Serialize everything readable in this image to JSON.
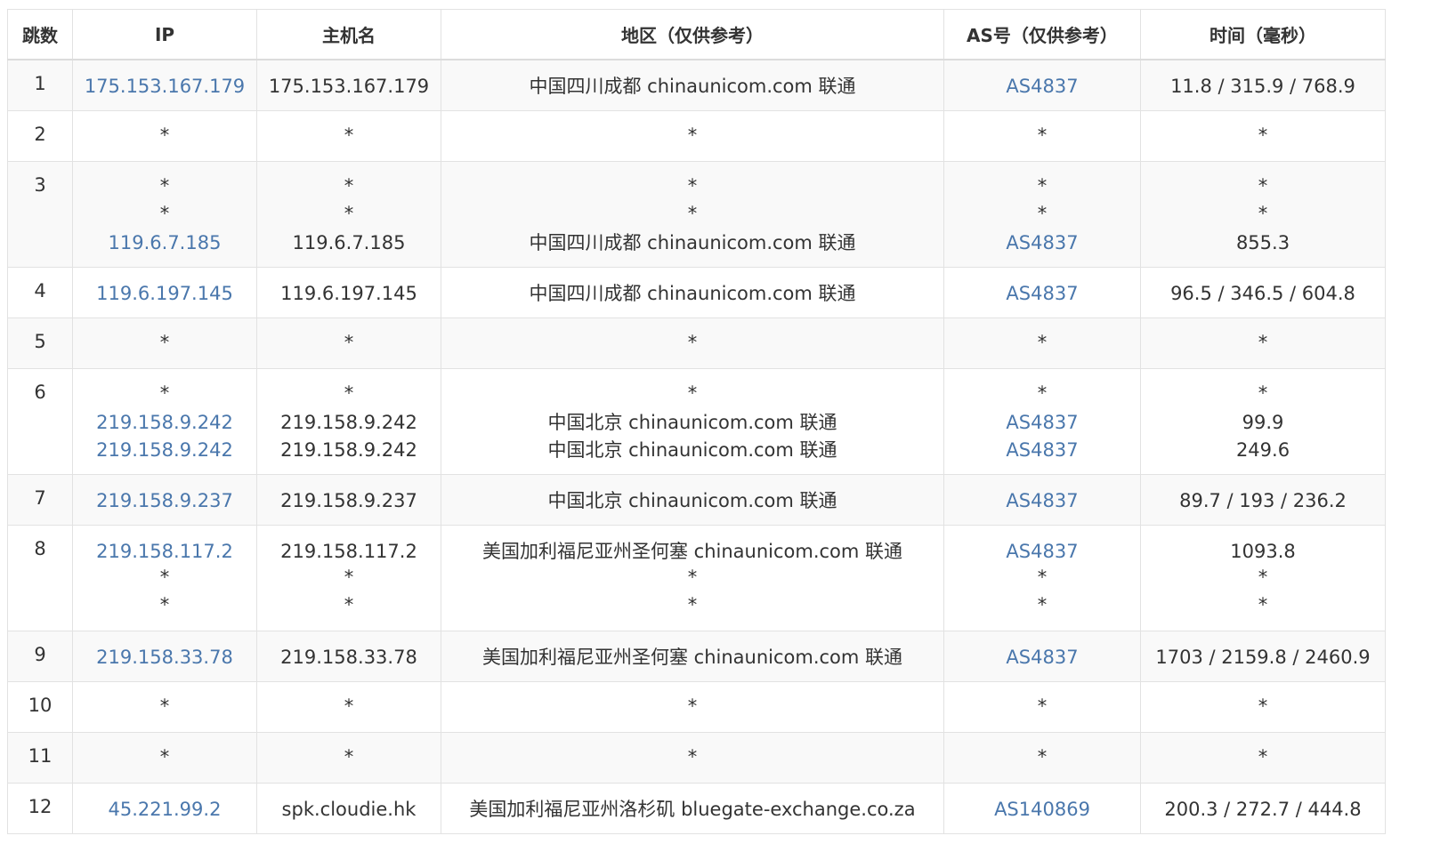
{
  "table": {
    "headers": {
      "hop": "跳数",
      "ip": "IP",
      "host": "主机名",
      "region": "地区（仅供参考）",
      "as": "AS号（仅供参考）",
      "time": "时间（毫秒）"
    },
    "rows": [
      {
        "hop": "1",
        "ip": [
          "175.153.167.179"
        ],
        "host": [
          "175.153.167.179"
        ],
        "region": [
          "中国四川成都 chinaunicom.com 联通"
        ],
        "as": [
          "AS4837"
        ],
        "time": [
          "11.8 / 315.9 / 768.9"
        ]
      },
      {
        "hop": "2",
        "ip": [
          "*"
        ],
        "host": [
          "*"
        ],
        "region": [
          "*"
        ],
        "as": [
          "*"
        ],
        "time": [
          "*"
        ]
      },
      {
        "hop": "3",
        "ip": [
          "*",
          "*",
          "119.6.7.185"
        ],
        "host": [
          "*",
          "*",
          "119.6.7.185"
        ],
        "region": [
          "*",
          "*",
          "中国四川成都 chinaunicom.com 联通"
        ],
        "as": [
          "*",
          "*",
          "AS4837"
        ],
        "time": [
          "*",
          "*",
          "855.3"
        ]
      },
      {
        "hop": "4",
        "ip": [
          "119.6.197.145"
        ],
        "host": [
          "119.6.197.145"
        ],
        "region": [
          "中国四川成都 chinaunicom.com 联通"
        ],
        "as": [
          "AS4837"
        ],
        "time": [
          "96.5 / 346.5 / 604.8"
        ]
      },
      {
        "hop": "5",
        "ip": [
          "*"
        ],
        "host": [
          "*"
        ],
        "region": [
          "*"
        ],
        "as": [
          "*"
        ],
        "time": [
          "*"
        ]
      },
      {
        "hop": "6",
        "ip": [
          "*",
          "219.158.9.242",
          "219.158.9.242"
        ],
        "host": [
          "*",
          "219.158.9.242",
          "219.158.9.242"
        ],
        "region": [
          "*",
          "中国北京 chinaunicom.com 联通",
          "中国北京 chinaunicom.com 联通"
        ],
        "as": [
          "*",
          "AS4837",
          "AS4837"
        ],
        "time": [
          "*",
          "99.9",
          "249.6"
        ]
      },
      {
        "hop": "7",
        "ip": [
          "219.158.9.237"
        ],
        "host": [
          "219.158.9.237"
        ],
        "region": [
          "中国北京 chinaunicom.com 联通"
        ],
        "as": [
          "AS4837"
        ],
        "time": [
          "89.7 / 193 / 236.2"
        ]
      },
      {
        "hop": "8",
        "ip": [
          "219.158.117.2",
          "*",
          "*"
        ],
        "host": [
          "219.158.117.2",
          "*",
          "*"
        ],
        "region": [
          "美国加利福尼亚州圣何塞 chinaunicom.com 联通",
          "*",
          "*"
        ],
        "as": [
          "AS4837",
          "*",
          "*"
        ],
        "time": [
          "1093.8",
          "*",
          "*"
        ]
      },
      {
        "hop": "9",
        "ip": [
          "219.158.33.78"
        ],
        "host": [
          "219.158.33.78"
        ],
        "region": [
          "美国加利福尼亚州圣何塞 chinaunicom.com 联通"
        ],
        "as": [
          "AS4837"
        ],
        "time": [
          "1703 / 2159.8 / 2460.9"
        ]
      },
      {
        "hop": "10",
        "ip": [
          "*"
        ],
        "host": [
          "*"
        ],
        "region": [
          "*"
        ],
        "as": [
          "*"
        ],
        "time": [
          "*"
        ]
      },
      {
        "hop": "11",
        "ip": [
          "*"
        ],
        "host": [
          "*"
        ],
        "region": [
          "*"
        ],
        "as": [
          "*"
        ],
        "time": [
          "*"
        ]
      },
      {
        "hop": "12",
        "ip": [
          "45.221.99.2"
        ],
        "host": [
          "spk.cloudie.hk"
        ],
        "region": [
          "美国加利福尼亚州洛杉矶 bluegate-exchange.co.za"
        ],
        "as": [
          "AS140869"
        ],
        "time": [
          "200.3 / 272.7 / 444.8"
        ]
      }
    ]
  },
  "colors": {
    "link": "#4a77ac",
    "text": "#333333",
    "stripe": "#f9f9f9",
    "border": "#e2e2e2"
  }
}
